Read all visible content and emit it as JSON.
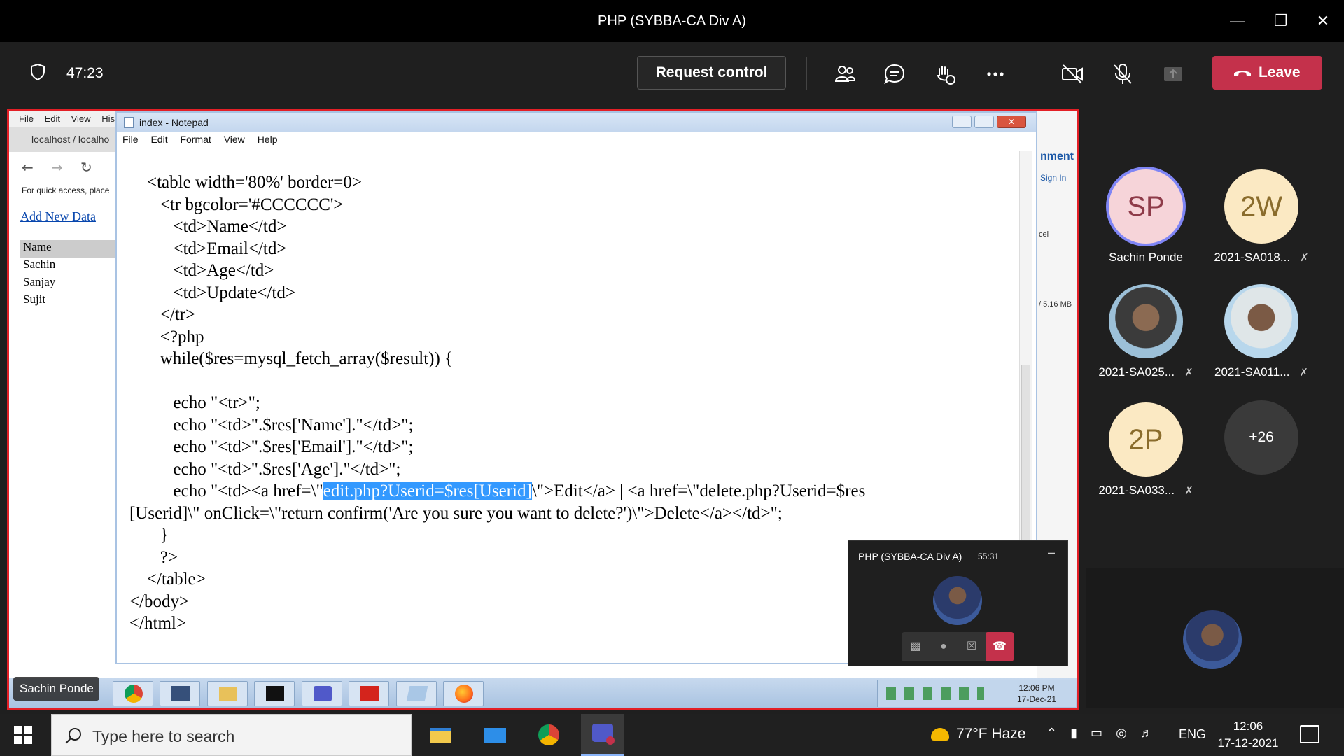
{
  "window": {
    "title": "PHP (SYBBA-CA Div A)"
  },
  "meeting": {
    "timer": "47:23",
    "request_control_label": "Request control",
    "leave_label": "Leave",
    "icons": [
      "shield-icon",
      "participants-icon",
      "chat-icon",
      "reactions-icon",
      "more-icon",
      "camera-off-icon",
      "mic-off-icon",
      "share-icon",
      "phone-icon"
    ]
  },
  "shared": {
    "browser": {
      "menu": [
        "File",
        "Edit",
        "View",
        "Hist"
      ],
      "tab": "localhost / localho",
      "quick_access": "For quick access, place",
      "add_new": "Add New Data",
      "names_header": "Name",
      "names": [
        "Sachin",
        "Sanjay",
        "Sujit"
      ]
    },
    "notepad": {
      "title": "index - Notepad",
      "menu": [
        "File",
        "Edit",
        "Format",
        "View",
        "Help"
      ],
      "lines": [
        "    <table width='80%' border=0>",
        "       <tr bgcolor='#CCCCCC'>",
        "          <td>Name</td>",
        "          <td>Email</td>",
        "          <td>Age</td>",
        "          <td>Update</td>",
        "       </tr>",
        "       <?php",
        "       while($res=mysql_fetch_array($result)) {",
        "",
        "          echo \"<tr>\";",
        "          echo \"<td>\".$res['Name'].\"</td>\";",
        "          echo \"<td>\".$res['Email'].\"</td>\";",
        "          echo \"<td>\".$res['Age'].\"</td>\";"
      ],
      "line_href_before": "          echo \"<td><a href=\\\"",
      "line_href_selected": "edit.php?Userid=$res[Userid]",
      "line_href_after": "\\\">Edit</a> | <a href=\\\"delete.php?Userid=$res",
      "lines_after": [
        "[Userid]\\\" onClick=\\\"return confirm('Are you sure you want to delete?')\\\">Delete</a></td>\";",
        "       }",
        "       ?>",
        "    </table>",
        "</body>",
        "</html>"
      ]
    },
    "right_panel": {
      "heading": "nment",
      "signin": "Sign In",
      "cel": "cel",
      "size": "/ 5.16 MB"
    },
    "xp_taskbar": {
      "time": "12:06 PM",
      "date": "17-Dec-21",
      "presenter_label": "Sachin Ponde"
    }
  },
  "popup": {
    "title": "PHP (SYBBA-CA Div A)",
    "time": "55:31"
  },
  "participants": [
    {
      "initials": "SP",
      "name": "Sachin Ponde",
      "muted": false
    },
    {
      "initials": "2W",
      "name": "2021-SA018...",
      "muted": true
    },
    {
      "initials": "",
      "name": "2021-SA025...",
      "muted": true
    },
    {
      "initials": "",
      "name": "2021-SA011...",
      "muted": true
    },
    {
      "initials": "2P",
      "name": "2021-SA033...",
      "muted": true
    },
    {
      "initials": "+26",
      "name": "",
      "muted": false
    }
  ],
  "taskbar": {
    "search_placeholder": "Type here to search",
    "weather": "77°F  Haze",
    "lang": "ENG",
    "time": "12:06",
    "date": "17-12-2021"
  }
}
